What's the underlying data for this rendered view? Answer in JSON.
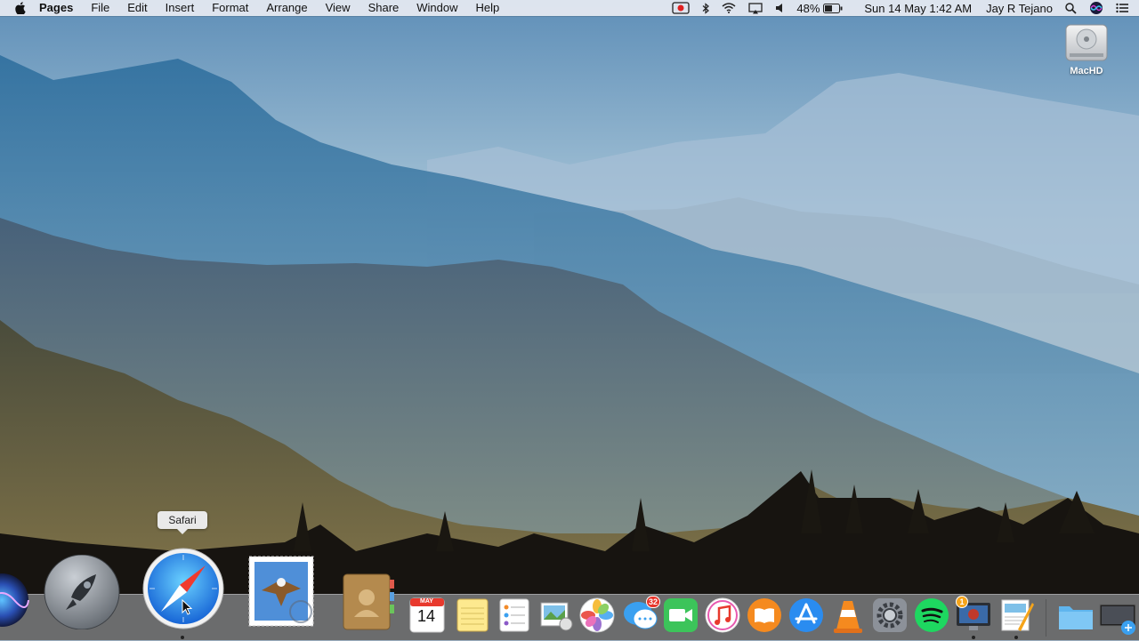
{
  "menubar": {
    "app_name": "Pages",
    "menus": [
      "File",
      "Edit",
      "Insert",
      "Format",
      "Arrange",
      "View",
      "Share",
      "Window",
      "Help"
    ],
    "status": {
      "battery": "48%",
      "datetime": "Sun 14 May  1:42 AM",
      "user": "Jay R Tejano"
    },
    "icons": [
      "record-icon",
      "bluetooth-icon",
      "wifi-icon",
      "airplay-icon",
      "volume-icon",
      "battery-icon",
      "spotlight-search-icon",
      "siri-icon",
      "notification-center-icon"
    ]
  },
  "desktop": {
    "items": [
      {
        "label": "MacHD",
        "icon": "hard-drive-icon"
      }
    ]
  },
  "dock": {
    "tooltip": "Safari",
    "calendar": {
      "month": "MAY",
      "day": "14"
    },
    "apps": [
      {
        "name": "Siri",
        "icon": "siri-icon"
      },
      {
        "name": "Launchpad",
        "icon": "rocket-icon"
      },
      {
        "name": "Safari",
        "icon": "compass-icon",
        "running": true
      },
      {
        "name": "Mail",
        "icon": "stamp-eagle-icon"
      },
      {
        "name": "Contacts",
        "icon": "address-book-icon"
      },
      {
        "name": "Calendar",
        "icon": "calendar-icon"
      },
      {
        "name": "Notes",
        "icon": "notes-icon"
      },
      {
        "name": "Reminders",
        "icon": "list-icon"
      },
      {
        "name": "Preview",
        "icon": "photo-slides-icon"
      },
      {
        "name": "Photos",
        "icon": "flower-icon"
      },
      {
        "name": "Messages",
        "icon": "speech-bubbles-icon",
        "badge": "32"
      },
      {
        "name": "FaceTime",
        "icon": "video-camera-icon"
      },
      {
        "name": "iTunes",
        "icon": "music-note-icon"
      },
      {
        "name": "iBooks",
        "icon": "book-icon"
      },
      {
        "name": "App Store",
        "icon": "app-store-icon"
      },
      {
        "name": "VLC",
        "icon": "traffic-cone-icon"
      },
      {
        "name": "System Preferences",
        "icon": "gear-icon"
      },
      {
        "name": "Spotify",
        "icon": "spotify-icon"
      },
      {
        "name": "Photo Booth",
        "icon": "monitor-icon",
        "badge": "1"
      },
      {
        "name": "Pages",
        "icon": "pages-icon",
        "running": true
      },
      {
        "name": "Downloads Folder",
        "icon": "folder-icon"
      },
      {
        "name": "Screen Stack",
        "icon": "screenshot-stack-icon"
      }
    ]
  },
  "colors": {
    "sky_top": "#4f7ea8",
    "haze": "#c7dbe6",
    "forest_dark": "#1e1a12",
    "menubar_bg": "#e8ecf2"
  }
}
